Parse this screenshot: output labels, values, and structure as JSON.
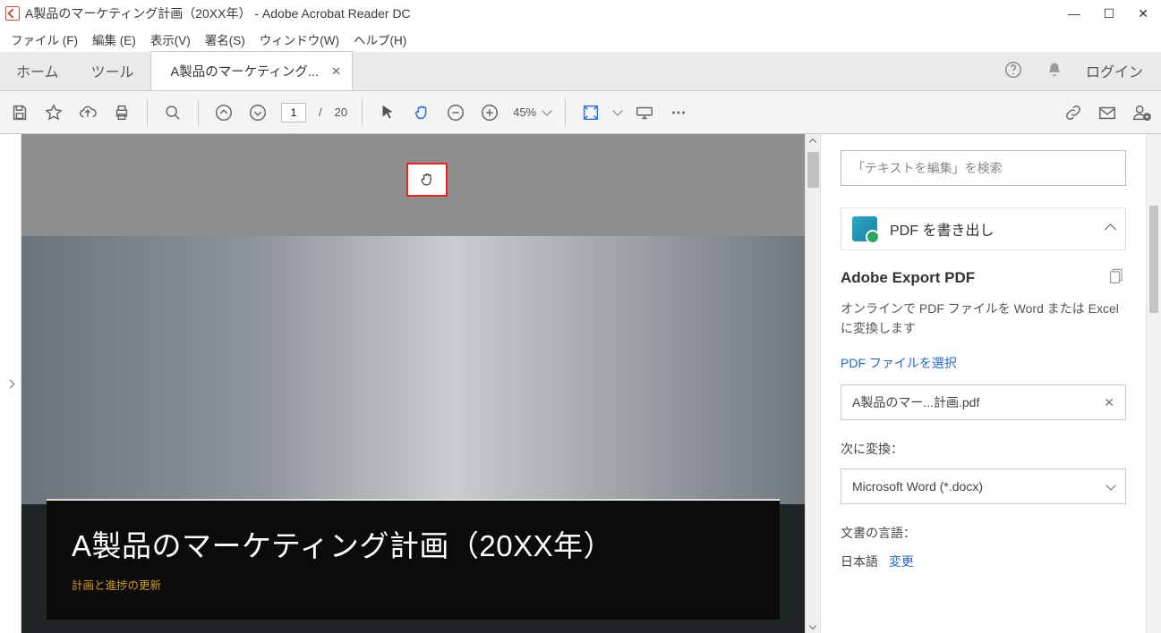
{
  "window": {
    "title": "A製品のマーケティング計画（20XX年） - Adobe Acrobat Reader DC"
  },
  "menubar": {
    "file": "ファイル (F)",
    "edit": "編集 (E)",
    "view": "表示(V)",
    "sign": "署名(S)",
    "window": "ウィンドウ(W)",
    "help": "ヘルプ(H)"
  },
  "tabstrip": {
    "home": "ホーム",
    "tools": "ツール",
    "doc_tab_label": "A製品のマーケティング...",
    "login": "ログイン"
  },
  "toolbar": {
    "page_current": "1",
    "page_sep": "/",
    "page_total": "20",
    "zoom_label": "45%"
  },
  "document": {
    "title": "A製品のマーケティング計画（20XX年）",
    "subtitle": "計画と進捗の更新"
  },
  "right_panel": {
    "search_placeholder": "「テキストを編集」を検索",
    "export_header": "PDF を書き出し",
    "section_title": "Adobe Export PDF",
    "section_desc": "オンラインで PDF ファイルを Word または Excel に変換します",
    "select_file_link": "PDF ファイルを選択",
    "selected_file": "A製品のマー...計画.pdf",
    "convert_to_label": "次に変換：",
    "convert_to_value": "Microsoft Word (*.docx)",
    "doc_lang_label": "文書の言語：",
    "doc_lang_value": "日本語",
    "change_link": "変更"
  }
}
